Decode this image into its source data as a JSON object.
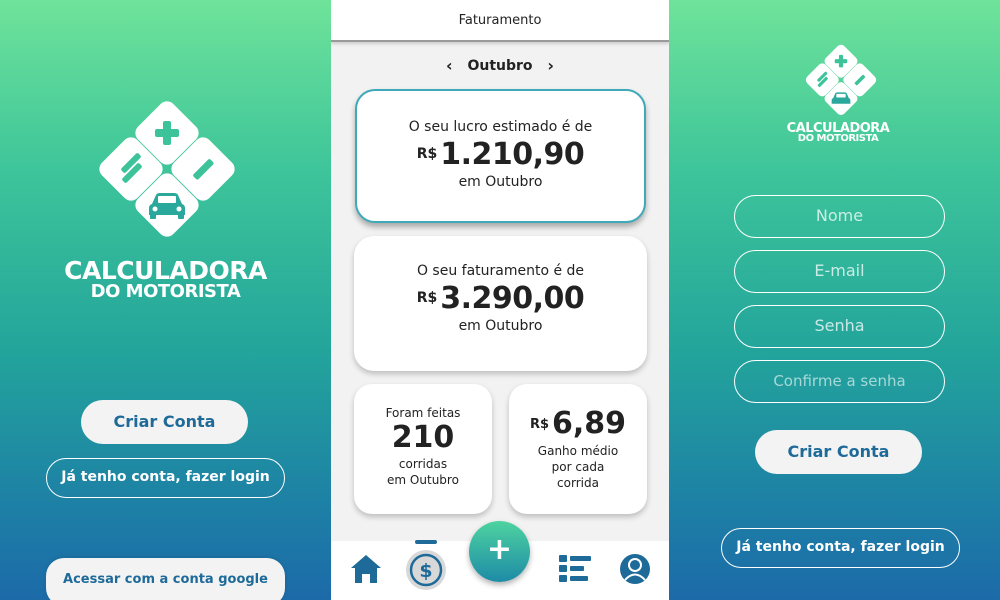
{
  "left_screen": {
    "logo": {
      "line1": "CALCULADORA",
      "line2": "DO MOTORISTA"
    },
    "create_account_label": "Criar Conta",
    "login_label": "Já tenho conta, fazer login",
    "google_label": "Acessar com a conta google"
  },
  "middle_screen": {
    "header_title": "Faturamento",
    "month": "Outubro",
    "month_prev_icon": "‹",
    "month_next_icon": "›",
    "profit_card": {
      "caption": "O seu lucro estimado é de",
      "currency": "R$",
      "value": "1.210,90",
      "suffix": "em Outubro"
    },
    "revenue_card": {
      "caption": "O seu faturamento é de",
      "currency": "R$",
      "value": "3.290,00",
      "suffix": "em Outubro"
    },
    "rides_card": {
      "caption": "Foram feitas",
      "value": "210",
      "line1": "corridas",
      "line2": "em Outubro"
    },
    "avg_card": {
      "currency": "R$",
      "value": "6,89",
      "line1": "Ganho médio",
      "line2": "por cada",
      "line3": "corrida"
    },
    "bottom_nav": {
      "items": [
        "home-icon",
        "dollar-icon",
        "add-icon",
        "list-icon",
        "profile-icon"
      ],
      "active": "dollar-icon",
      "fab_symbol": "+"
    }
  },
  "right_screen": {
    "logo": {
      "line1": "CALCULADORA",
      "line2": "DO MOTORISTA"
    },
    "fields": {
      "name_placeholder": "Nome",
      "email_placeholder": "E-mail",
      "password_placeholder": "Senha",
      "confirm_placeholder": "Confirme a senha"
    },
    "create_account_label": "Criar Conta",
    "login_label": "Já tenho conta, fazer login"
  },
  "colors": {
    "gradient_top": "#6fe39a",
    "gradient_bottom": "#1c6aa8",
    "button_text": "#1e6a99",
    "icon_blue": "#1e6a99"
  }
}
